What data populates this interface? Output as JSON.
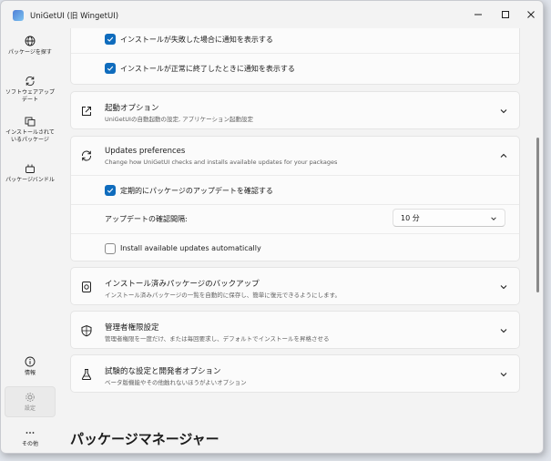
{
  "window": {
    "title": "UniGetUI (旧 WingetUI)",
    "minimize_label": "–",
    "maximize_label": "☐",
    "close_label": "✕"
  },
  "sidebar": {
    "items": [
      {
        "label": "パッケージを探す",
        "icon": "globe-icon"
      },
      {
        "label": "ソフトウェアアップデート",
        "icon": "refresh-icon"
      },
      {
        "label": "インストールされているパッケージ",
        "icon": "installed-packages-icon"
      },
      {
        "label": "パッケージバンドル",
        "icon": "bundle-icon"
      }
    ],
    "bottom_items": [
      {
        "label": "情報",
        "icon": "info-icon"
      },
      {
        "label": "設定",
        "icon": "gear-icon",
        "active": true
      },
      {
        "label": "その他",
        "icon": "more-icon"
      }
    ]
  },
  "notifications_card": {
    "options": [
      {
        "label": "インストールが失敗した場合に通知を表示する",
        "checked": true
      },
      {
        "label": "インストールが正常に終了したときに通知を表示する",
        "checked": true
      }
    ]
  },
  "startup_card": {
    "title": "起動オプション",
    "subtitle": "UniGetUIの自動起動の設定, アプリケーション起動設定"
  },
  "updates_card": {
    "title": "Updates preferences",
    "subtitle": "Change how UniGetUI checks and installs available updates for your packages",
    "check_label": "定期的にパッケージのアップデートを確認する",
    "check_checked": true,
    "interval_label": "アップデートの確認間隔:",
    "interval_value": "10 分",
    "auto_install_label": "Install available updates automatically",
    "auto_install_checked": false
  },
  "backup_card": {
    "title": "インストール済みパッケージのバックアップ",
    "subtitle": "インストール済みパッケージの一覧を自動的に保存し、簡単に復元できるようにします。"
  },
  "admin_card": {
    "title": "管理者権限設定",
    "subtitle": "管理者権限を一度だけ、または毎回要求し、デフォルトでインストールを昇格させる"
  },
  "experimental_card": {
    "title": "試験的な設定と開発者オプション",
    "subtitle": "ベータ版機能やその他触れないほうがよいオプション"
  },
  "section_heading": "パッケージマネージャー",
  "colors": {
    "accent": "#0f6cbd",
    "background": "#f3f3f3",
    "card": "#fbfbfb"
  }
}
